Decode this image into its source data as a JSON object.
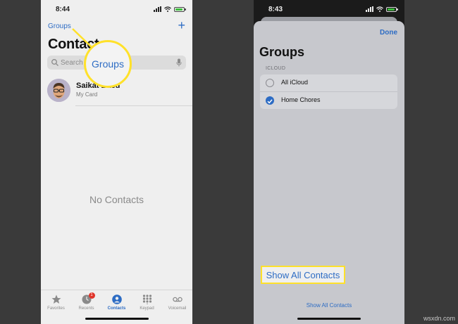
{
  "left_phone": {
    "status_time": "8:44",
    "groups_link": "Groups",
    "plus_symbol": "+",
    "title": "Contacts",
    "search_placeholder": "Search",
    "my_card": {
      "name": "Saikat Basu",
      "subtitle": "My Card"
    },
    "empty_message": "No Contacts",
    "tabs": [
      {
        "label": "Favorites",
        "icon": "star-icon"
      },
      {
        "label": "Recents",
        "icon": "clock-icon",
        "badge": "1"
      },
      {
        "label": "Contacts",
        "icon": "person-icon",
        "active": true
      },
      {
        "label": "Keypad",
        "icon": "keypad-icon"
      },
      {
        "label": "Voicemail",
        "icon": "voicemail-icon"
      }
    ],
    "zoom_callout": "Groups"
  },
  "right_phone": {
    "status_time": "8:43",
    "done_label": "Done",
    "title": "Groups",
    "section_label": "ICLOUD",
    "groups": [
      {
        "label": "All iCloud",
        "checked": false
      },
      {
        "label": "Home Chores",
        "checked": true
      }
    ],
    "show_all_label": "Show All Contacts",
    "callout_label": "Show All Contacts"
  },
  "watermark": "wsxdn.com",
  "colors": {
    "accent": "#2d6cc4",
    "highlight": "#ffe12a",
    "badge": "#e0352b"
  }
}
